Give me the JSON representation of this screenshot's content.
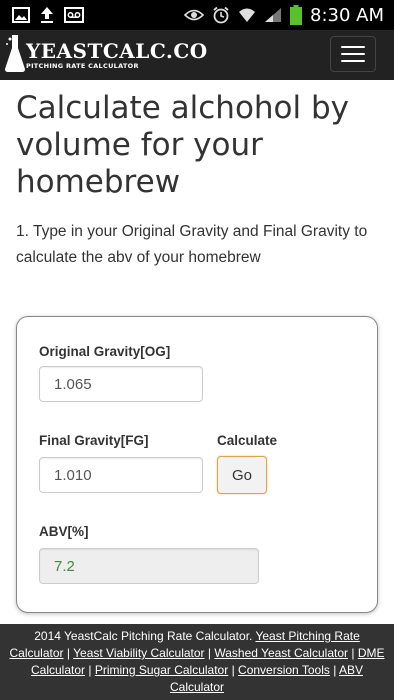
{
  "status_bar": {
    "time": "8:30 AM",
    "left_icons": [
      "gallery-icon",
      "upload-icon",
      "voicemail-icon"
    ],
    "right_icons": [
      "eye-icon",
      "alarm-icon",
      "wifi-icon",
      "signal-icon",
      "battery-icon"
    ],
    "battery_color": "#58c22b"
  },
  "navbar": {
    "brand_name": "YEASTCALC.CO",
    "brand_tagline": "PITCHING RATE CALCULATOR",
    "logo_icon": "flask-icon",
    "menu_icon": "hamburger-menu-icon"
  },
  "page": {
    "title": "Calculate alchohol by volume for your homebrew",
    "intro": "1. Type in your Original Gravity and Final Gravity to calculate the abv of your homebrew"
  },
  "form": {
    "og_label": "Original Gravity[OG]",
    "og_value": "1.065",
    "fg_label": "Final Gravity[FG]",
    "fg_value": "1.010",
    "calc_label": "Calculate",
    "go_label": "Go",
    "abv_label": "ABV[%]",
    "abv_value": "7.2",
    "abv_color": "#3c8c3c",
    "go_border_color": "#d9a64a"
  },
  "footer": {
    "copyright": "2014 YeastCalc Pitching Rate Calculator.",
    "links": [
      "Yeast Pitching Rate Calculator",
      "Yeast Viability Calculator",
      "Washed Yeast Calculator",
      "DME Calculator",
      "Priming Sugar Calculator",
      "Conversion Tools",
      "ABV Calculator"
    ],
    "separator": "|"
  }
}
